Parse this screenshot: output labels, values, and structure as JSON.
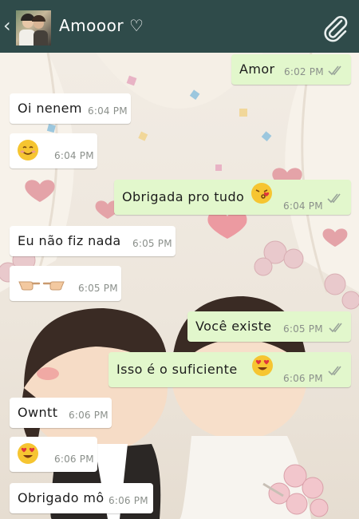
{
  "header": {
    "back_icon": "chevron-left-icon",
    "contact_name": "Amooor ♡",
    "attach_icon": "paperclip-icon"
  },
  "colors": {
    "header_bg": "#2f4b4a",
    "incoming_bubble": "#ffffff",
    "outgoing_bubble": "#e2f7cc",
    "time_text": "#8a8f8a",
    "read_ticks": "#9aa59a"
  },
  "messages": [
    {
      "side": "out",
      "text": "Amor",
      "time": "6:02 PM",
      "ticks": "double-check-icon"
    },
    {
      "side": "in",
      "text": "Oi nenem",
      "time": "6:04 PM"
    },
    {
      "side": "in",
      "text": "",
      "emoji": "smiling-face-icon",
      "time": "6:04 PM"
    },
    {
      "side": "out",
      "text": "Obrigada pro tudo",
      "emoji": "kissing-face-icon",
      "time": "6:04 PM",
      "ticks": "double-check-icon"
    },
    {
      "side": "in",
      "text": "Eu não fiz nada",
      "time": "6:05 PM"
    },
    {
      "side": "in",
      "text": "",
      "emoji": "pointing-hands-icon",
      "time": "6:05 PM"
    },
    {
      "side": "out",
      "text": "Você existe",
      "time": "6:05 PM",
      "ticks": "double-check-icon"
    },
    {
      "side": "out",
      "text": "Isso é o suficiente",
      "emoji": "heart-eyes-icon",
      "time": "6:06 PM",
      "ticks": "double-check-icon"
    },
    {
      "side": "in",
      "text": "Owntt",
      "time": "6:06 PM"
    },
    {
      "side": "in",
      "text": "",
      "emoji": "heart-eyes-icon",
      "time": "6:06 PM"
    },
    {
      "side": "in",
      "text": "Obrigado mô",
      "time": "6:06 PM"
    }
  ]
}
